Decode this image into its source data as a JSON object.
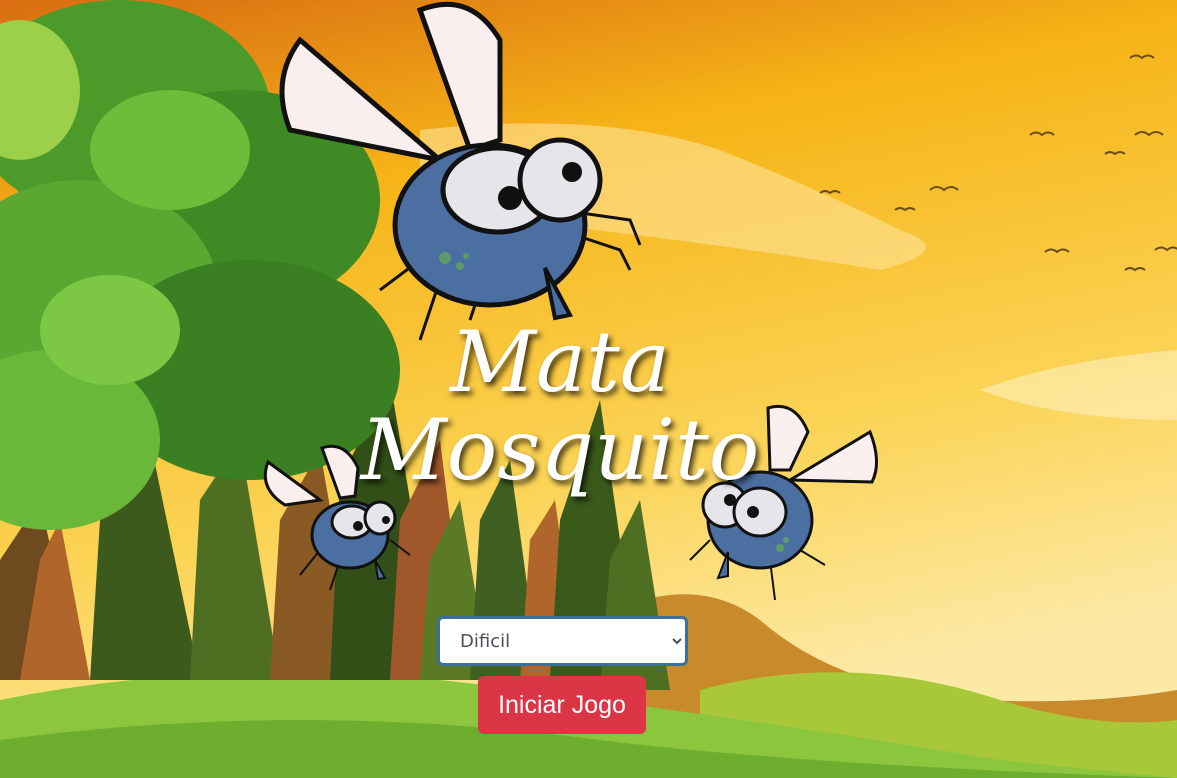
{
  "title": {
    "line1": "Mata",
    "line2": "Mosquito"
  },
  "difficulty": {
    "selected": "Dificil",
    "options": [
      "Dificil"
    ]
  },
  "start_button": {
    "label": "Iniciar Jogo"
  },
  "colors": {
    "button": "#dc3545",
    "sky_top": "#e07a16",
    "sky_bottom": "#fde9a6",
    "grass": "#8cc63f",
    "tree_green": "#4c9a2a",
    "mosquito_body": "#4a6fa0"
  }
}
